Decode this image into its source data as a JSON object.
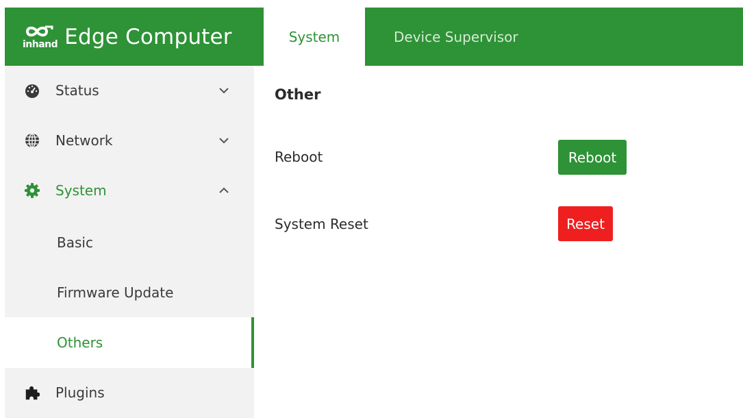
{
  "brand": {
    "logo_text": "inhand",
    "title": "Edge Computer"
  },
  "tabs": [
    {
      "label": "System",
      "active": true
    },
    {
      "label": "Device Supervisor",
      "active": false
    }
  ],
  "sidebar": {
    "items": [
      {
        "label": "Status",
        "icon": "dashboard-icon",
        "chevron": "chevron-down-icon"
      },
      {
        "label": "Network",
        "icon": "globe-icon",
        "chevron": "chevron-down-icon"
      },
      {
        "label": "System",
        "icon": "gear-icon",
        "chevron": "chevron-up-icon"
      },
      {
        "label": "Plugins",
        "icon": "puzzle-icon"
      }
    ],
    "system_sub": [
      {
        "label": "Basic"
      },
      {
        "label": "Firmware Update"
      },
      {
        "label": "Others",
        "selected": true
      }
    ]
  },
  "main": {
    "section_title": "Other",
    "rows": [
      {
        "label": "Reboot",
        "button": "Reboot",
        "button_color": "#2e9236"
      },
      {
        "label": "System Reset",
        "button": "Reset",
        "button_color": "#f01f1f"
      }
    ]
  },
  "colors": {
    "brand_green": "#2e9236",
    "sidebar_bg": "#f2f2f2",
    "danger_red": "#f01f1f"
  }
}
